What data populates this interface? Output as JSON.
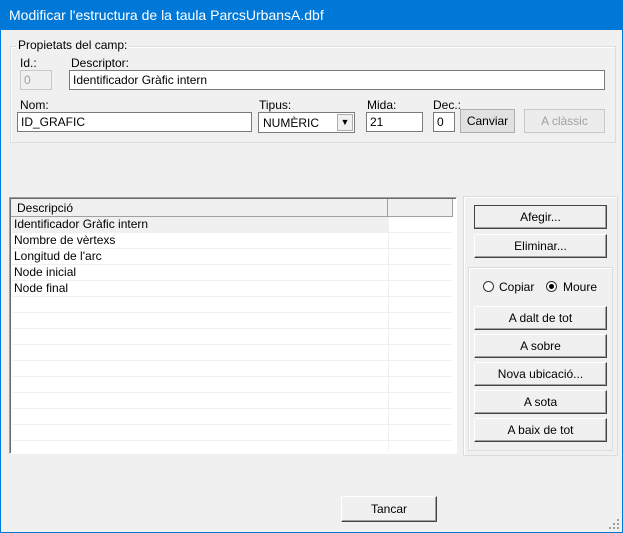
{
  "window": {
    "title": "Modificar l'estructura de la taula ParcsUrbansA.dbf"
  },
  "field_props": {
    "legend": "Propietats del camp:",
    "id_label": "Id.:",
    "id_value": "0",
    "descriptor_label": "Descriptor:",
    "descriptor_value": "Identificador Gràfic intern",
    "nom_label": "Nom:",
    "nom_value": "ID_GRAFIC",
    "tipus_label": "Tipus:",
    "tipus_value": "NUMÈRIC",
    "mida_label": "Mida:",
    "mida_value": "21",
    "dec_label": "Dec.:",
    "dec_value": "0",
    "canviar_label": "Canviar",
    "classic_label": "A clàssic"
  },
  "list": {
    "header": "Descripció",
    "items": [
      "Identificador Gràfic intern",
      "Nombre de vèrtexs",
      "Longitud de l'arc",
      "Node inicial",
      "Node final"
    ],
    "selected_index": 0
  },
  "actions": {
    "afegir": "Afegir...",
    "eliminar": "Eliminar...",
    "copiar": "Copiar",
    "moure": "Moure",
    "mode_selected": "Moure",
    "dalt": "A dalt de tot",
    "sobre": "A sobre",
    "nova": "Nova ubicació...",
    "sota": "A sota",
    "baix": "A baix de tot"
  },
  "footer": {
    "tancar": "Tancar"
  }
}
